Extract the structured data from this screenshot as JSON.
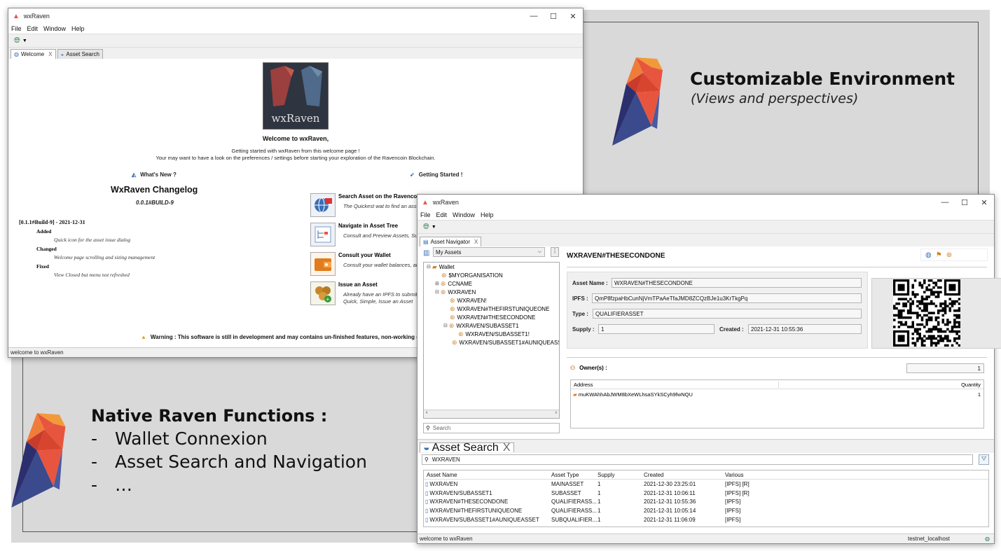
{
  "promo": {
    "title1": "Customizable Environment",
    "subtitle1": "(Views and perspectives)",
    "title2": "Native Raven Functions :",
    "bullet_dash": "-",
    "items": [
      "Wallet Connexion",
      "Asset Search and Navigation",
      "…"
    ]
  },
  "window1": {
    "title": "wxRaven",
    "controls": {
      "min": "—",
      "max": "☐",
      "close": "✕"
    },
    "menu": [
      "File",
      "Edit",
      "Window",
      "Help"
    ],
    "tabs": [
      {
        "label": "Welcome",
        "close": "X"
      },
      {
        "label": "Asset Search"
      }
    ],
    "welcome": {
      "logo_text": "wxRaven",
      "heading": "Welcome to wxRaven,",
      "line1": "Getting started with wxRaven from this welcome page !",
      "line2": "Your may want to have a look on the preferences / settings before starting your exploration of the Ravencoin Blockchain.",
      "whats_new": "What's New ?",
      "getting_started": "Getting Started !",
      "changelog_title": "WxRaven Changelog",
      "changelog_version": "0.0.1#BUILD-9",
      "changelog_entry": "[0.1.1#Build-9] - 2021-12-31",
      "added_label": "Added",
      "added_text": "Quick icon for the asset issue dialog",
      "changed_label": "Changed",
      "changed_text": "Welcome page scrolling and sizing management",
      "fixed_label": "Fixed",
      "fixed_text": "View Closed but menu not refreshed",
      "actions": [
        {
          "title": "Search Asset on the Ravencoin Blockchain",
          "desc": "The Quickest wat to find an asset"
        },
        {
          "title": "Navigate in Asset Tree",
          "desc": "Consult and  Preview Assets, Sub-Assets"
        },
        {
          "title": "Consult your Wallet",
          "desc": "Consult your wallet balances, addresses"
        },
        {
          "title": "Issue an Asset",
          "desc": "Already have an IPFS to submit ?",
          "desc2": "Quick, Simple, Issue an Asset"
        }
      ],
      "warning": "Warning : This software is still in development and may contains un-finished features, non-working code"
    },
    "status": "welcome to wxRaven"
  },
  "window2": {
    "title": "wxRaven",
    "controls": {
      "min": "—",
      "max": "☐",
      "close": "✕"
    },
    "menu": [
      "File",
      "Edit",
      "Window",
      "Help"
    ],
    "nav_tab": {
      "label": "Asset Navigator",
      "close": "X"
    },
    "dropdown_value": "My Assets",
    "tree": [
      {
        "label": "Wallet",
        "depth": 0
      },
      {
        "label": "$MYORGANISATION",
        "depth": 1
      },
      {
        "label": "CCNAME",
        "depth": 1
      },
      {
        "label": "WXRAVEN",
        "depth": 1
      },
      {
        "label": "WXRAVEN!",
        "depth": 2
      },
      {
        "label": "WXRAVEN#THEFIRSTUNIQUEONE",
        "depth": 2
      },
      {
        "label": "WXRAVEN#THESECONDONE",
        "depth": 2
      },
      {
        "label": "WXRAVEN/SUBASSET1",
        "depth": 2
      },
      {
        "label": "WXRAVEN/SUBASSET1!",
        "depth": 3
      },
      {
        "label": "WXRAVEN/SUBASSET1#AUNIQUEASSET",
        "depth": 3
      }
    ],
    "search_placeholder": "Search",
    "asset_title": "WXRAVEN#THESECONDONE",
    "details": {
      "asset_name_label": "Asset Name :",
      "asset_name": "WXRAVEN#THESECONDONE",
      "ipfs_label": "IPFS :",
      "ipfs": "QmP8fzpaHbCunNjVmTPaAeTfaJMD8ZCQzBJe1u3KrTkgPq",
      "type_label": "Type :",
      "type": "QUALIFIERASSET",
      "supply_label": "Supply :",
      "supply": "1",
      "created_label": "Created :",
      "created": "2021-12-31 10:55:36"
    },
    "owners_label": "Owner(s) :",
    "owners_count": "1",
    "owners_headers": [
      "Address",
      "Quantity"
    ],
    "owners_rows": [
      {
        "address": "muKWAhhAbJWM8bXeWLhsaSYkSCyh9fwNQU",
        "quantity": "1"
      }
    ],
    "search_tab": {
      "label": "Asset Search",
      "close": "X"
    },
    "search_value": "WXRAVEN",
    "results_headers": [
      "Asset Name",
      "Asset Type",
      "Supply",
      "Created",
      "Various"
    ],
    "results": [
      {
        "name": "WXRAVEN",
        "type": "MAINASSET",
        "supply": "1",
        "created": "2021-12-30 23:25:01",
        "various": "[IPFS] [R]"
      },
      {
        "name": "WXRAVEN/SUBASSET1",
        "type": "SUBASSET",
        "supply": "1",
        "created": "2021-12-31 10:06:11",
        "various": "[IPFS] [R]"
      },
      {
        "name": "WXRAVEN#THESECONDONE",
        "type": "QUALIFIERASS...",
        "supply": "1",
        "created": "2021-12-31 10:55:36",
        "various": "[IPFS]"
      },
      {
        "name": "WXRAVEN#THEFIRSTUNIQUEONE",
        "type": "QUALIFIERASS...",
        "supply": "1",
        "created": "2021-12-31 10:05:14",
        "various": "[IPFS]"
      },
      {
        "name": "WXRAVEN/SUBASSET1#AUNIQUEASSET",
        "type": "SUBQUALIFIER...",
        "supply": "1",
        "created": "2021-12-31 11:06:09",
        "various": "[IPFS]"
      }
    ],
    "status_left": "welcome to wxRaven",
    "status_right": "testnet_localhost"
  },
  "colors": {
    "raven_red": "#e8553e",
    "raven_orange": "#f29a3a",
    "raven_blue": "#3a4a8c",
    "raven_dark": "#2c2f6e",
    "background": "#d9d9d9"
  },
  "icons": [
    "raven-logo-icon",
    "globe-icon",
    "rocket-icon",
    "warning-icon",
    "search-icon",
    "filter-icon",
    "folder-icon",
    "coin-icon",
    "document-icon",
    "qr-code-icon"
  ]
}
